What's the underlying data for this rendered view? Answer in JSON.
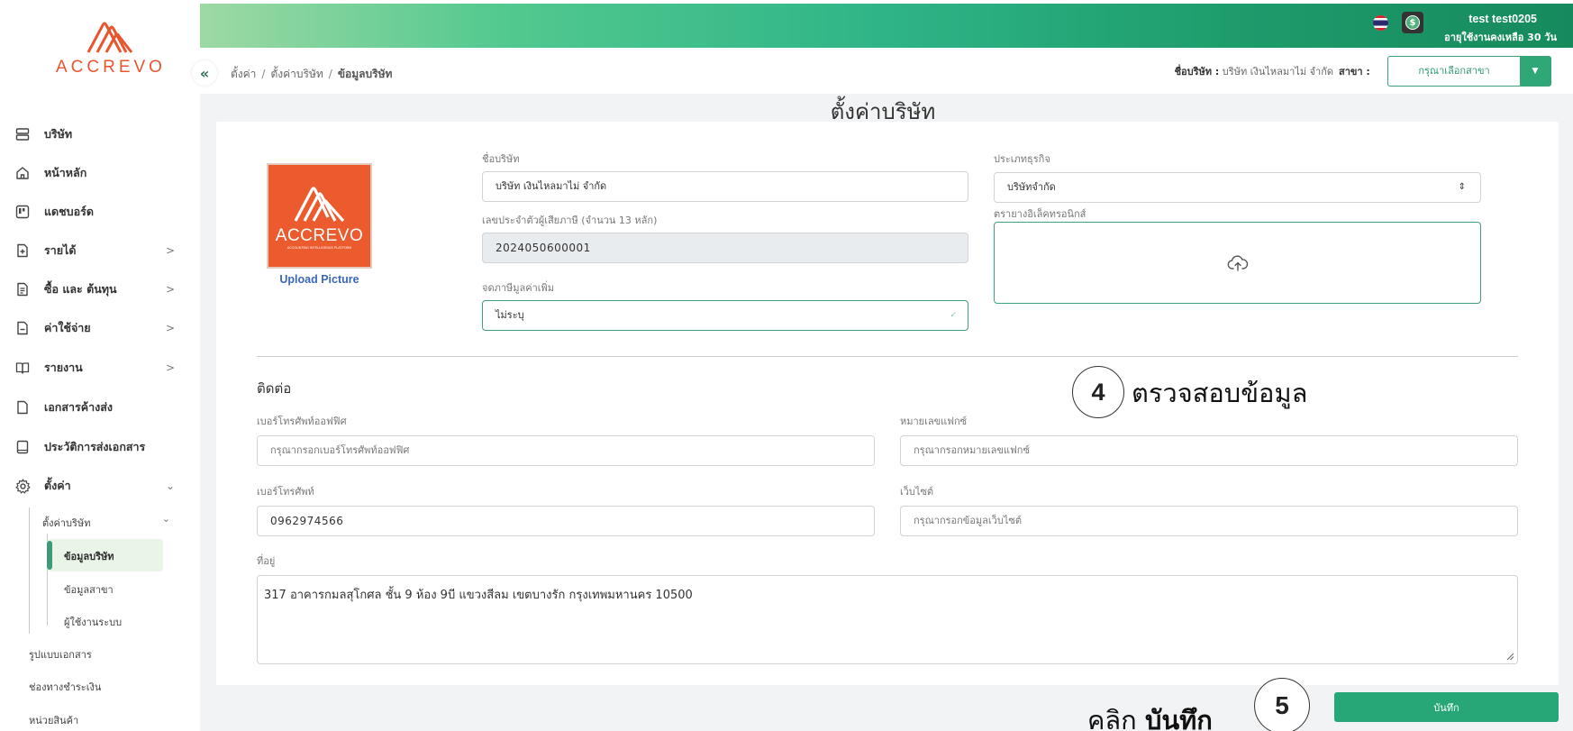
{
  "brand": {
    "name": "ACCREVO",
    "logo_tagline": "ACCOUNTING INTELLIGENCE PLATFORM"
  },
  "colors": {
    "accent": "#27a777",
    "brand_orange": "#ec5b2e",
    "upload_blue": "#3b67b7"
  },
  "sidebar": {
    "items": [
      {
        "label": "บริษัท",
        "icon": "building-icon"
      },
      {
        "label": "หน้าหลัก",
        "icon": "home-icon"
      },
      {
        "label": "แดชบอร์ด",
        "icon": "dashboard-icon"
      },
      {
        "label": "รายได้",
        "icon": "income-icon",
        "chevron": ">"
      },
      {
        "label": "ซื้อ และ ต้นทุน",
        "icon": "purchase-icon",
        "chevron": ">"
      },
      {
        "label": "ค่าใช้จ่าย",
        "icon": "expense-icon",
        "chevron": ">"
      },
      {
        "label": "รายงาน",
        "icon": "report-book-icon",
        "chevron": ">"
      },
      {
        "label": "เอกสารค้างส่ง",
        "icon": "pending-document-icon"
      },
      {
        "label": "ประวัติการส่งเอกสาร",
        "icon": "document-history-icon"
      },
      {
        "label": "ตั้งค่า",
        "icon": "gear-icon",
        "chevron": "v"
      }
    ],
    "settings_sub": {
      "company_settings": "ตั้งค่าบริษัท",
      "company_info": "ข้อมูลบริษัท",
      "branch_info": "ข้อมูลสาขา",
      "system_users": "ผู้ใช้งานระบบ",
      "document_format": "รูปแบบเอกสาร",
      "payment_channels": "ช่องทางชำระเงิน",
      "product_units": "หน่วยสินค้า"
    }
  },
  "topbar": {
    "user_name": "test test0205",
    "days_left": "อายุใช้งานคงเหลือ 30 วัน"
  },
  "breadcrumb": {
    "items": [
      "ตั้งค่า",
      "ตั้งค่าบริษัท"
    ],
    "current": "ข้อมูลบริษัท",
    "separator": "/"
  },
  "header": {
    "company_label": "ชื่อบริษัท :",
    "company_value": "บริษัท เงินไหลมาไม่ จำกัด",
    "branch_label": "สาขา :",
    "branch_placeholder": "กรุณาเลือกสาขา"
  },
  "page": {
    "title": "ตั้งค่าบริษัท"
  },
  "form": {
    "upload_label": "Upload Picture",
    "company_name_label": "ชื่อบริษัท",
    "company_name_value": "บริษัท เงินไหลมาไม่ จำกัด",
    "tax_id_label": "เลขประจำตัวผู้เสียภาษี (จำนวน 13 หลัก)",
    "tax_id_value": "2024050600001",
    "vat_label": "จดภาษีมูลค่าเพิ่ม",
    "vat_value": "ไม่ระบุ",
    "business_type_label": "ประเภทธุรกิจ",
    "business_type_value": "บริษัทจำกัด",
    "esign_label": "ตรายางอิเล็คทรอนิกส์"
  },
  "contact": {
    "title": "ติดต่อ",
    "office_phone_label": "เบอร์โทรศัพท์ออฟฟิศ",
    "office_phone_placeholder": "กรุณากรอกเบอร์โทรศัพท์ออฟฟิศ",
    "fax_label": "หมายเลขแฟกซ์",
    "fax_placeholder": "กรุณากรอกหมายเลขแฟกซ์",
    "phone_label": "เบอร์โทรศัพท์",
    "phone_value": "0962974566",
    "website_label": "เว็บไซต์",
    "website_placeholder": "กรุณากรอกข้อมูลเว็บไซต์",
    "address_label": "ที่อยู่",
    "address_value": "317 อาคารกมลสุโกศล ชั้น 9 ห้อง 9บี แขวงสีลม เขตบางรัก กรุงเทพมหานคร 10500"
  },
  "annotations": {
    "step4_num": "4",
    "step4_text": "ตรวจสอบข้อมูล",
    "step5_num": "5",
    "step5_prefix": "คลิก",
    "step5_bold": "บันทึก"
  },
  "actions": {
    "save_label": "บันทึก"
  }
}
